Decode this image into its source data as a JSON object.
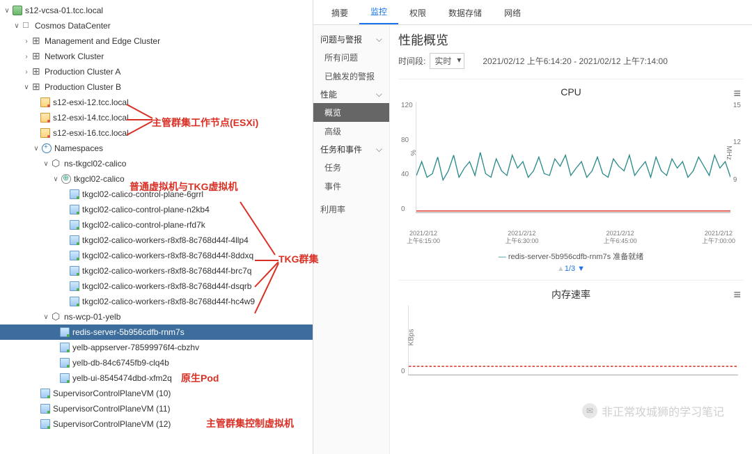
{
  "tree": {
    "root": "s12-vcsa-01.tcc.local",
    "datacenter": "Cosmos DataCenter",
    "clusters": [
      "Management and Edge Cluster",
      "Network Cluster",
      "Production Cluster A",
      "Production Cluster B"
    ],
    "hosts": [
      "s12-esxi-12.tcc.local",
      "s12-esxi-14.tcc.local",
      "s12-esxi-16.tcc.local"
    ],
    "namespaces_label": "Namespaces",
    "ns1": "ns-tkgcl02-calico",
    "tkg_cluster": "tkgcl02-calico",
    "tkg_vms": [
      "tkgcl02-calico-control-plane-6grrl",
      "tkgcl02-calico-control-plane-n2kb4",
      "tkgcl02-calico-control-plane-rfd7k",
      "tkgcl02-calico-workers-r8xf8-8c768d44f-4llp4",
      "tkgcl02-calico-workers-r8xf8-8c768d44f-8ddxq",
      "tkgcl02-calico-workers-r8xf8-8c768d44f-brc7q",
      "tkgcl02-calico-workers-r8xf8-8c768d44f-dsqrb",
      "tkgcl02-calico-workers-r8xf8-8c768d44f-hc4w9"
    ],
    "ns2": "ns-wcp-01-yelb",
    "pods": [
      "redis-server-5b956cdfb-rnm7s",
      "yelb-appserver-78599976f4-cbzhv",
      "yelb-db-84c6745fb9-clq4b",
      "yelb-ui-8545474dbd-xfm2q"
    ],
    "supervisor": [
      "SupervisorControlPlaneVM (10)",
      "SupervisorControlPlaneVM (11)",
      "SupervisorControlPlaneVM (12)"
    ]
  },
  "annotations": {
    "esxi": "主管群集工作节点(ESXi)",
    "tkgvms": "普通虚拟机与TKG虚拟机",
    "tkgcluster": "TKG群集",
    "pod": "原生Pod",
    "supervisor": "主管群集控制虚拟机"
  },
  "tabs": [
    "摘要",
    "监控",
    "权限",
    "数据存储",
    "网络"
  ],
  "active_tab": "监控",
  "sidebar": {
    "group1": {
      "label": "问题与警报",
      "items": [
        "所有问题",
        "已触发的警报"
      ]
    },
    "group2": {
      "label": "性能",
      "items": [
        "概览",
        "高级"
      ],
      "active": "概览"
    },
    "group3": {
      "label": "任务和事件",
      "items": [
        "任务",
        "事件"
      ]
    },
    "item4": "利用率"
  },
  "perf": {
    "title": "性能概览",
    "time_label": "时间段:",
    "time_value": "实时",
    "time_range": "2021/02/12 上午6:14:20 - 2021/02/12 上午7:14:00",
    "legend_series": "redis-server-5b956cdfb-rnm7s 准备就绪",
    "pager": "1/3"
  },
  "chart_data": [
    {
      "type": "line",
      "title": "CPU",
      "xlabel": "",
      "ylabel_left": "%",
      "ylabel_right": "MHz",
      "ylim_left": [
        0,
        120
      ],
      "ylim_right": [
        0,
        15
      ],
      "x_categories": [
        "2021/2/12\n上午6:15:00",
        "2021/2/12\n上午6:30:00",
        "2021/2/12\n上午6:45:00",
        "2021/2/12\n上午7:00:00"
      ],
      "series": [
        {
          "name": "redis-server-5b956cdfb-rnm7s 准备就绪",
          "color": "#2a8a8a",
          "values": [
            40,
            55,
            38,
            42,
            60,
            35,
            45,
            62,
            38,
            48,
            55,
            40,
            65,
            42,
            38,
            58,
            45,
            40,
            62,
            48,
            55,
            38,
            45,
            60,
            42,
            40,
            58,
            50,
            62,
            40,
            48,
            55,
            38,
            45,
            60,
            42,
            38,
            58,
            50,
            45,
            62,
            40,
            48,
            55,
            38,
            60,
            45,
            40,
            58,
            48,
            55,
            38,
            45,
            60,
            50,
            40,
            62,
            48,
            55,
            38
          ]
        }
      ],
      "baseline": {
        "color": "#d93025",
        "value": 0
      }
    },
    {
      "type": "line",
      "title": "内存速率",
      "ylabel_left": "KBps",
      "ylim_left": [
        0,
        1
      ],
      "series": [
        {
          "name": "",
          "color": "#2a8a8a",
          "values": [
            0,
            0,
            0,
            0,
            0,
            0,
            0,
            0,
            0,
            0
          ]
        }
      ]
    }
  ],
  "watermark": "非正常攻城狮的学习笔记"
}
